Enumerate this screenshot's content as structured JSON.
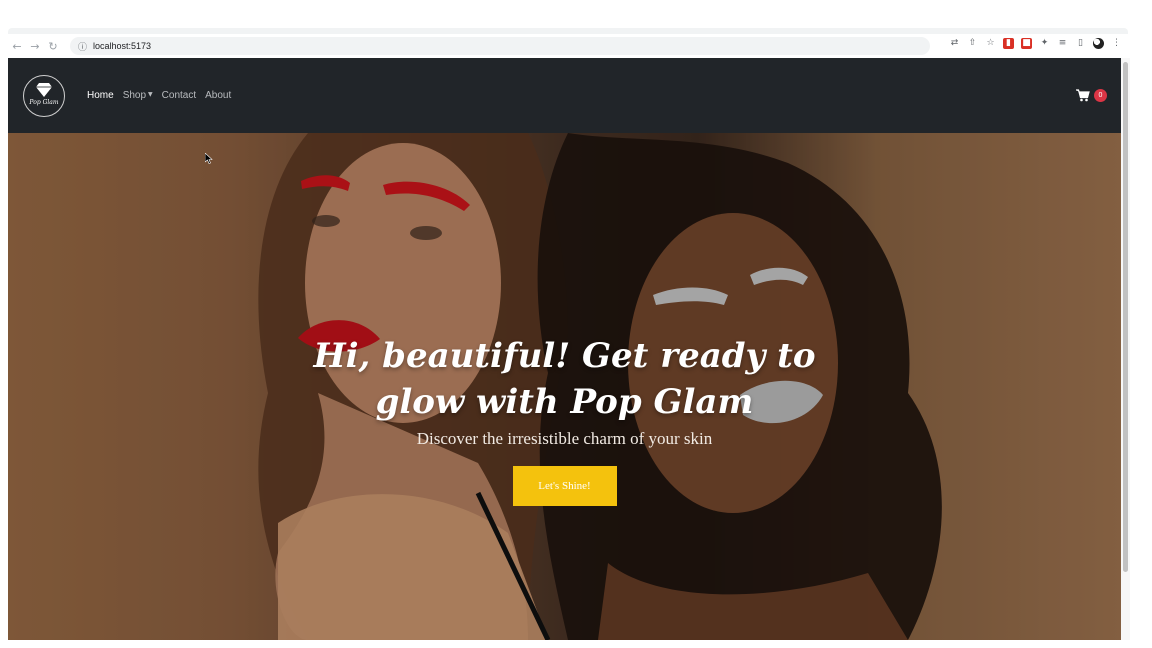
{
  "browser": {
    "url": "localhost:5173",
    "nav_icons": [
      "back-arrow-icon",
      "forward-arrow-icon",
      "reload-icon"
    ],
    "extension_icons": [
      "translate-icon",
      "share-icon",
      "star-icon",
      "extension-red-icon",
      "extension-red-square-icon",
      "puzzle-icon",
      "media-icon",
      "side-panel-icon",
      "profile-avatar-icon",
      "menu-dots-icon"
    ]
  },
  "navbar": {
    "logo_text": "Pop Glam",
    "links": [
      {
        "label": "Home",
        "active": true
      },
      {
        "label": "Shop",
        "dropdown": true
      },
      {
        "label": "Contact"
      },
      {
        "label": "About"
      }
    ],
    "cart_count": "0"
  },
  "hero": {
    "title": "Hi, beautiful! Get ready to glow with Pop Glam",
    "subtitle": "Discover the irresistible charm of your skin",
    "cta_label": "Let's Shine!"
  },
  "colors": {
    "navbar_bg": "#212529",
    "cta_bg": "#f4c20d",
    "badge_bg": "#dc3545"
  }
}
